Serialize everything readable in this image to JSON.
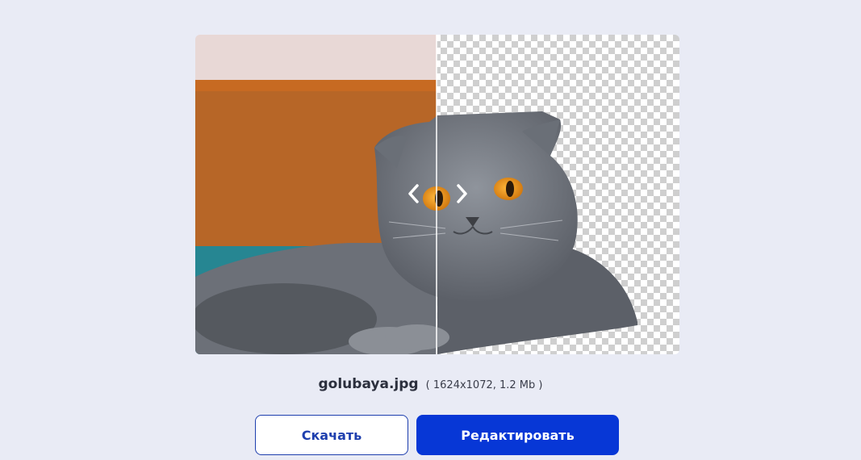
{
  "file": {
    "name": "golubaya.jpg",
    "meta": "( 1624x1072, 1.2 Mb )"
  },
  "actions": {
    "download_label": "Скачать",
    "edit_label": "Редактировать"
  },
  "comparison": {
    "split_position": 0.5
  },
  "colors": {
    "background": "#e9ebf5",
    "primary": "#0737d6",
    "outline": "#1e3fae"
  },
  "icons": {
    "slider_handle": [
      "chevron-left-icon",
      "chevron-right-icon"
    ]
  }
}
